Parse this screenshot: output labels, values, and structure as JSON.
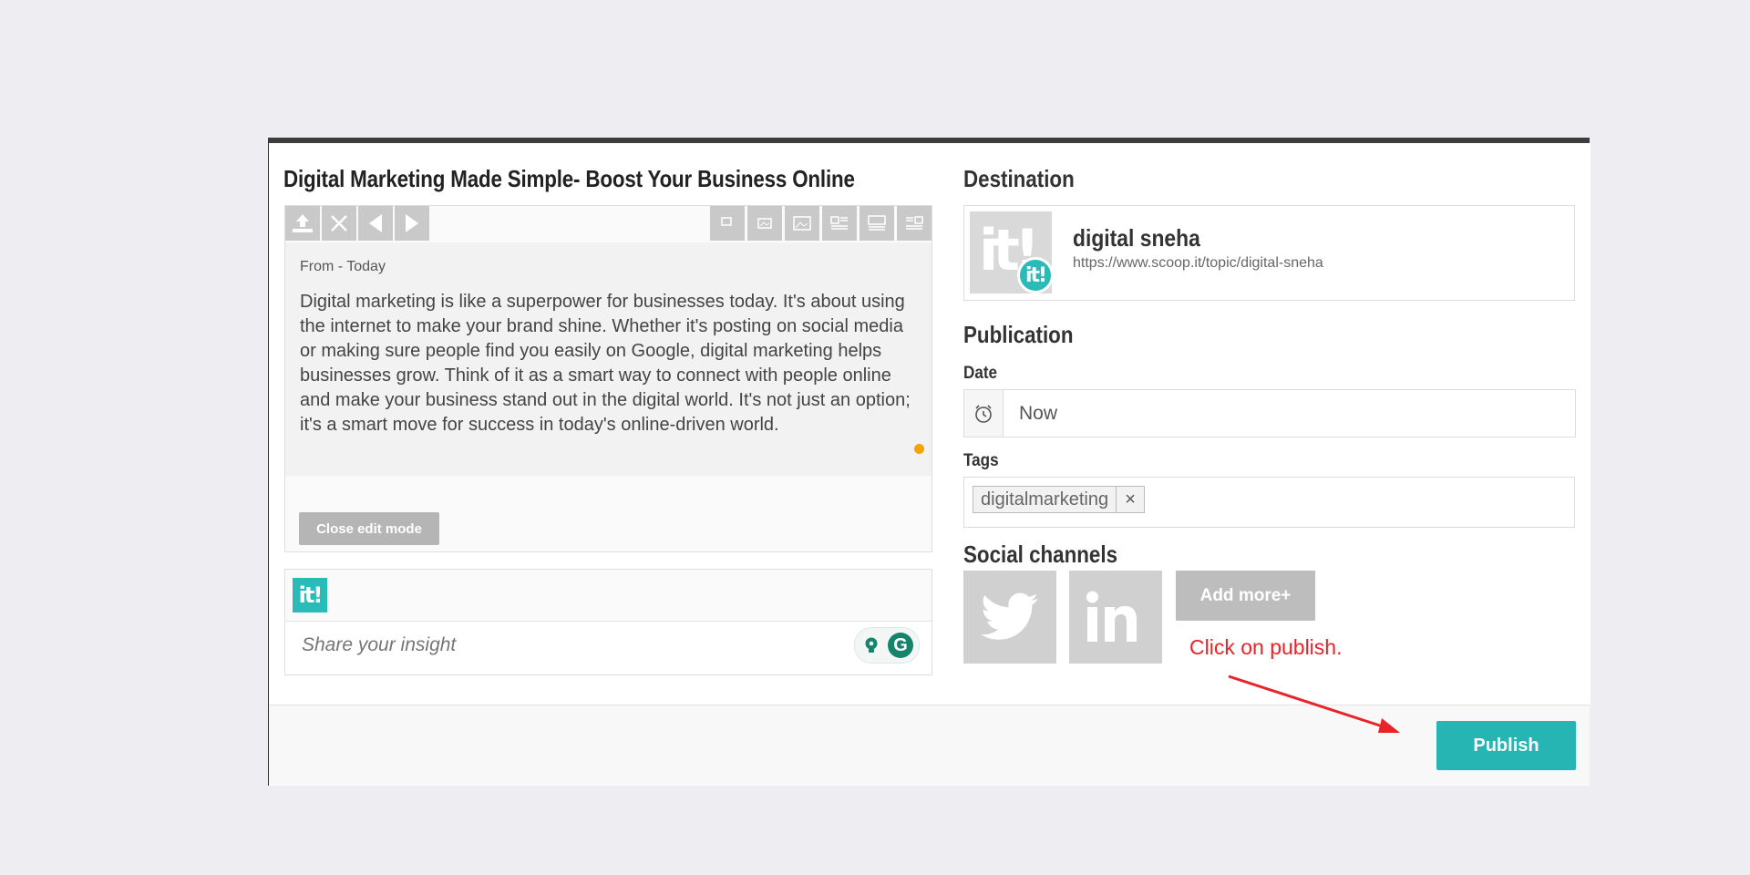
{
  "post": {
    "title": "Digital Marketing Made Simple- Boost Your Business Online",
    "from_line": "From - Today",
    "body": "Digital marketing is like a superpower for businesses today. It's about using the internet to make your brand shine. Whether it's posting on social media or making sure people find you easily on Google, digital marketing helps businesses grow. Think of it as a smart way to connect with people online and make your business stand out in the digital world. It's not just an option; it's a smart move for success in today's online-driven world.",
    "close_edit_label": "Close edit mode"
  },
  "toolbar": {
    "left_buttons": [
      "upload-icon",
      "close-icon",
      "prev-arrow-icon",
      "next-arrow-icon"
    ],
    "layout_buttons": [
      "layout-1-icon",
      "layout-2-icon",
      "layout-3-icon",
      "layout-4-icon",
      "layout-5-icon",
      "layout-6-icon"
    ]
  },
  "insight": {
    "logo_text": "it!",
    "placeholder": "Share your insight",
    "grammarly_letter": "G"
  },
  "destination": {
    "heading": "Destination",
    "logo_text": "it!",
    "badge_text": "it!",
    "name": "digital sneha",
    "url": "https://www.scoop.it/topic/digital-sneha"
  },
  "publication": {
    "heading": "Publication",
    "date_label": "Date",
    "date_value": "Now",
    "tags_label": "Tags",
    "tags": [
      "digitalmarketing"
    ],
    "tag_remove": "×"
  },
  "social": {
    "heading": "Social channels",
    "channels": [
      "twitter-icon",
      "linkedin-icon"
    ],
    "add_more_label": "Add more+"
  },
  "annotation": {
    "text": "Click on publish.",
    "color": "#e8242a"
  },
  "footer": {
    "publish_label": "Publish"
  },
  "colors": {
    "accent": "#2abbb8",
    "publish": "#26b5b2",
    "grammarly": "#15846b",
    "dot": "#f5a300"
  }
}
